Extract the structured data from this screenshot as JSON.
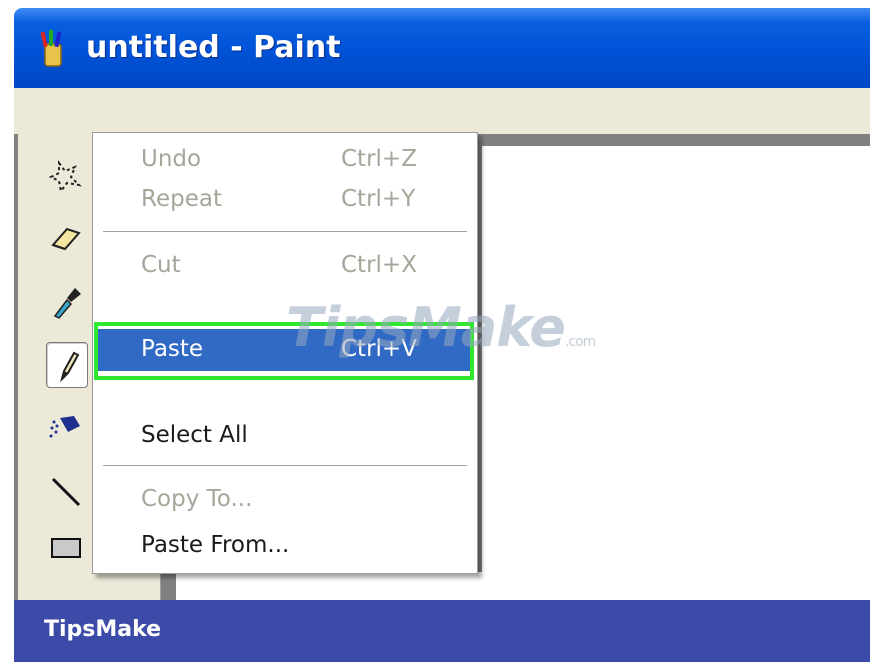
{
  "window": {
    "title": "untitled - Paint"
  },
  "edit_menu": {
    "items": [
      {
        "label": "Undo",
        "shortcut": "Ctrl+Z",
        "state": "disabled"
      },
      {
        "label": "Repeat",
        "shortcut": "Ctrl+Y",
        "state": "disabled"
      },
      {
        "label": "Cut",
        "shortcut": "Ctrl+X",
        "state": "disabled"
      },
      {
        "label": "Paste",
        "shortcut": "Ctrl+V",
        "state": "highlighted"
      },
      {
        "label": "Select All",
        "shortcut": "",
        "state": "enabled"
      },
      {
        "label": "Copy To...",
        "shortcut": "",
        "state": "disabled"
      },
      {
        "label": "Paste From...",
        "shortcut": "",
        "state": "enabled"
      }
    ]
  },
  "tools": [
    {
      "icon": "free-form-select-icon"
    },
    {
      "icon": "eraser-icon"
    },
    {
      "icon": "pick-color-icon"
    },
    {
      "icon": "pencil-icon",
      "active": true
    },
    {
      "icon": "airbrush-icon"
    },
    {
      "icon": "line-icon"
    },
    {
      "icon": "rectangle-icon"
    }
  ],
  "watermark": {
    "text": "TipsMake",
    "suffix": ".com"
  },
  "footer": {
    "brand": "TipsMake"
  },
  "colors": {
    "title_bar": "#0052d6",
    "menu_highlight": "#316ac5",
    "highlight_outline": "#2ee82e",
    "footer_bar": "#3d4ba8"
  }
}
